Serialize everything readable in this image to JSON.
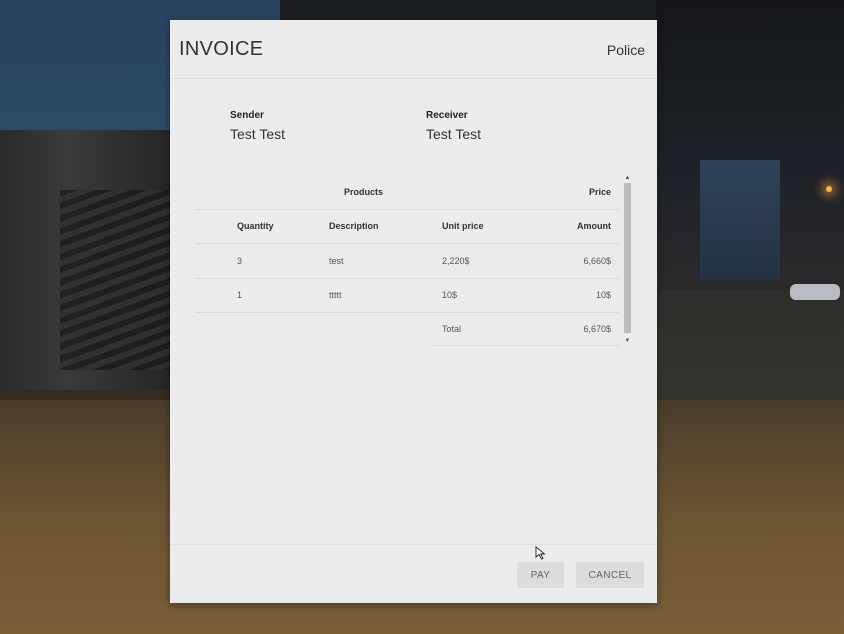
{
  "modal": {
    "title": "INVOICE",
    "organization": "Police"
  },
  "sender": {
    "label": "Sender",
    "name": "Test Test"
  },
  "receiver": {
    "label": "Receiver",
    "name": "Test Test"
  },
  "table": {
    "section_headers": {
      "products": "Products",
      "price": "Price"
    },
    "columns": [
      "Quantity",
      "Description",
      "Unit price",
      "Amount"
    ],
    "rows": [
      {
        "quantity": "3",
        "description": "test",
        "unit_price": "2,220$",
        "amount": "6,660$"
      },
      {
        "quantity": "1",
        "description": "ttttt",
        "unit_price": "10$",
        "amount": "10$"
      }
    ],
    "total_label": "Total",
    "total_value": "6,670$"
  },
  "scrollbar": {
    "up_icon": "triangle-up-icon",
    "down_icon": "triangle-down-icon"
  },
  "footer": {
    "pay_label": "PAY",
    "cancel_label": "CANCEL"
  }
}
